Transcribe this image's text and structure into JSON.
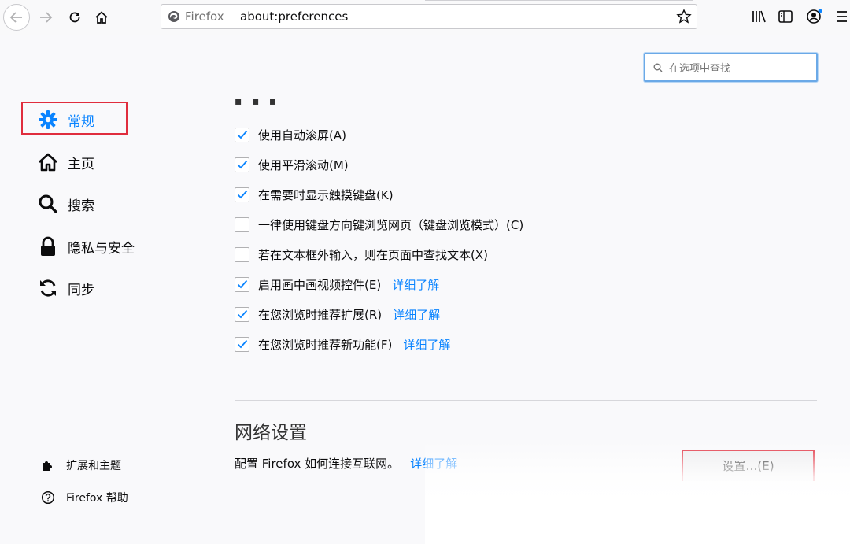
{
  "toolbar": {
    "identity_label": "Firefox",
    "url": "about:preferences"
  },
  "search": {
    "placeholder": "在选项中查找"
  },
  "sidebar": {
    "items": [
      {
        "label": "常规",
        "icon": "gear-icon",
        "active": true
      },
      {
        "label": "主页",
        "icon": "home-icon"
      },
      {
        "label": "搜索",
        "icon": "search-icon"
      },
      {
        "label": "隐私与安全",
        "icon": "lock-icon"
      },
      {
        "label": "同步",
        "icon": "sync-icon"
      }
    ],
    "bottom": [
      {
        "label": "扩展和主题",
        "icon": "puzzle-icon"
      },
      {
        "label": "Firefox 帮助",
        "icon": "help-icon"
      }
    ]
  },
  "browsing": {
    "options": [
      {
        "label": "使用自动滚屏(A)",
        "checked": true
      },
      {
        "label": "使用平滑滚动(M)",
        "checked": true
      },
      {
        "label": "在需要时显示触摸键盘(K)",
        "checked": true
      },
      {
        "label": "一律使用键盘方向键浏览网页（键盘浏览模式）(C)",
        "checked": false
      },
      {
        "label": "若在文本框外输入，则在页面中查找文本(X)",
        "checked": false
      },
      {
        "label": "启用画中画视频控件(E)",
        "checked": true,
        "link": "详细了解"
      },
      {
        "label": "在您浏览时推荐扩展(R)",
        "checked": true,
        "link": "详细了解"
      },
      {
        "label": "在您浏览时推荐新功能(F)",
        "checked": true,
        "link": "详细了解"
      }
    ]
  },
  "network": {
    "title": "网络设置",
    "description": "配置 Firefox 如何连接互联网。",
    "link": "详细了解",
    "button": "设置…(E)"
  },
  "colors": {
    "accent": "#0a84ff",
    "highlight": "#e02d3d"
  }
}
